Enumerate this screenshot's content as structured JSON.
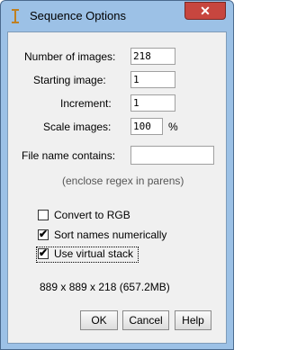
{
  "window": {
    "title": "Sequence Options",
    "close_glyph": "✕"
  },
  "fields": {
    "num_images": {
      "label": "Number of images:",
      "value": "218"
    },
    "starting_image": {
      "label": "Starting image:",
      "value": "1"
    },
    "increment": {
      "label": "Increment:",
      "value": "1"
    },
    "scale_images": {
      "label": "Scale images:",
      "value": "100",
      "unit": "%"
    },
    "file_name_contains": {
      "label": "File name contains:",
      "value": ""
    }
  },
  "hint": "(enclose regex in parens)",
  "checkboxes": [
    {
      "label": "Convert to RGB",
      "checked": false
    },
    {
      "label": "Sort names numerically",
      "checked": true
    },
    {
      "label": "Use virtual stack",
      "checked": true
    }
  ],
  "check_glyph": "✔",
  "info": "889 x 889 x 218 (657.2MB)",
  "buttons": {
    "ok": "OK",
    "cancel": "Cancel",
    "help": "Help"
  },
  "colors": {
    "titlebar": "#9cc1e6",
    "close": "#c7463f",
    "dialog_bg": "#f0f0f0"
  }
}
